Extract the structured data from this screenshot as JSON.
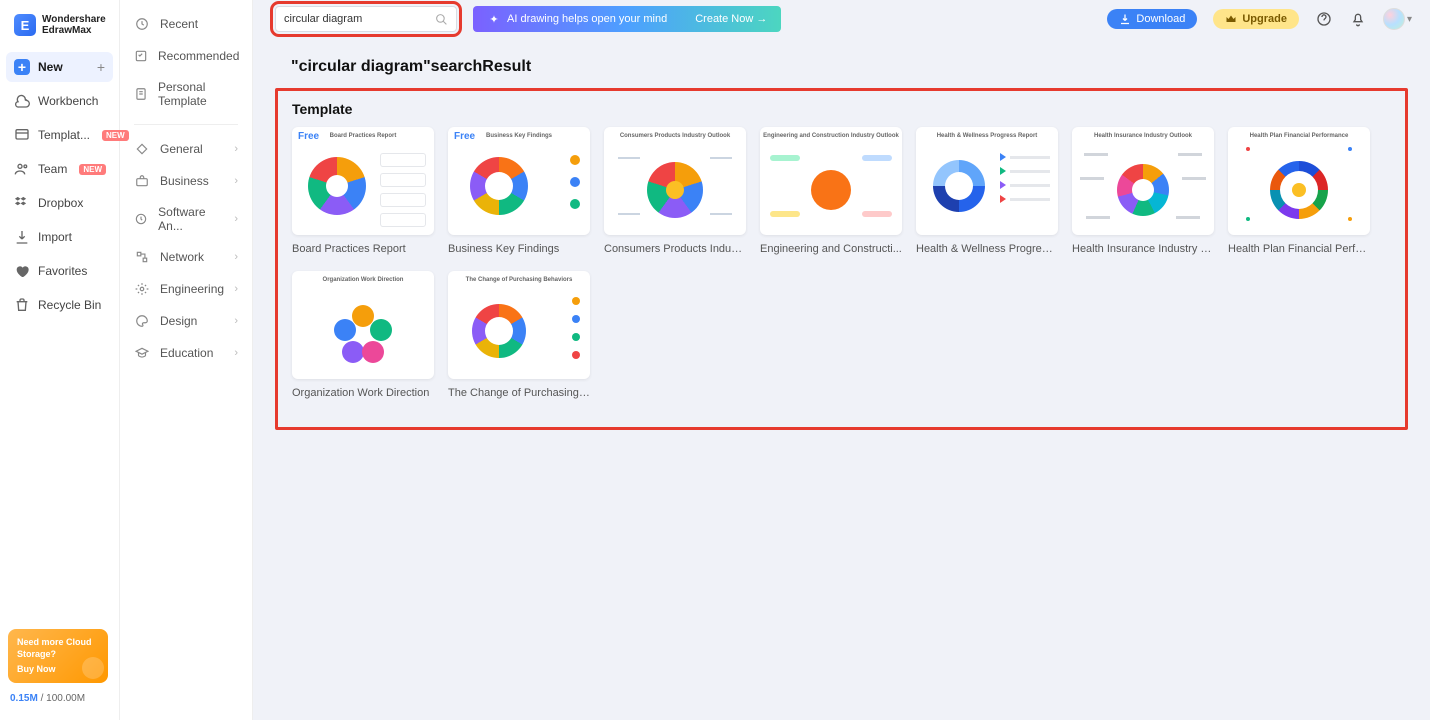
{
  "brand": {
    "line1": "Wondershare",
    "line2": "EdrawMax"
  },
  "sidebar1": {
    "new": "New",
    "items": [
      {
        "label": "Workbench"
      },
      {
        "label": "Templat...",
        "badge": "NEW"
      },
      {
        "label": "Team",
        "badge": "NEW"
      },
      {
        "label": "Dropbox"
      },
      {
        "label": "Import"
      },
      {
        "label": "Favorites"
      },
      {
        "label": "Recycle Bin"
      }
    ],
    "promo_line1": "Need more Cloud Storage?",
    "promo_cta": "Buy Now",
    "storage_used": "0.15M",
    "storage_sep": " / ",
    "storage_total": "100.00M"
  },
  "sidebar2": {
    "top": [
      {
        "label": "Recent"
      },
      {
        "label": "Recommended"
      },
      {
        "label": "Personal Template"
      }
    ],
    "cats": [
      {
        "label": "General"
      },
      {
        "label": "Business"
      },
      {
        "label": "Software An..."
      },
      {
        "label": "Network"
      },
      {
        "label": "Engineering"
      },
      {
        "label": "Design"
      },
      {
        "label": "Education"
      }
    ]
  },
  "topbar": {
    "search_value": "circular diagram",
    "ai_text": "AI drawing helps open your mind",
    "ai_cta": "Create Now →",
    "download": "Download",
    "upgrade": "Upgrade"
  },
  "results": {
    "heading": "\"circular diagram\"searchResult",
    "section": "Template",
    "free_label": "Free",
    "templates": [
      {
        "title": "Board Practices Report",
        "free": true,
        "variant": "v1",
        "tiny": "Board Practices Report"
      },
      {
        "title": "Business Key Findings",
        "free": true,
        "variant": "v2",
        "tiny": "Business Key Findings"
      },
      {
        "title": "Consumers Products Indust...",
        "free": false,
        "variant": "v3",
        "tiny": "Consumers Products Industry Outlook"
      },
      {
        "title": "Engineering and Constructi...",
        "free": false,
        "variant": "v4",
        "tiny": "Engineering and Construction Industry Outlook"
      },
      {
        "title": "Health & Wellness Progress ...",
        "free": false,
        "variant": "v5",
        "tiny": "Health & Wellness Progress Report"
      },
      {
        "title": "Health Insurance Industry O...",
        "free": false,
        "variant": "v6",
        "tiny": "Health Insurance Industry Outlook"
      },
      {
        "title": "Health Plan Financial Perfor...",
        "free": false,
        "variant": "v7",
        "tiny": "Health Plan Financial Performance"
      },
      {
        "title": "Organization Work Direction",
        "free": false,
        "variant": "v8",
        "tiny": "Organization Work Direction"
      },
      {
        "title": "The Change of Purchasing B...",
        "free": false,
        "variant": "v9",
        "tiny": "The Change of Purchasing Behaviors"
      }
    ]
  }
}
